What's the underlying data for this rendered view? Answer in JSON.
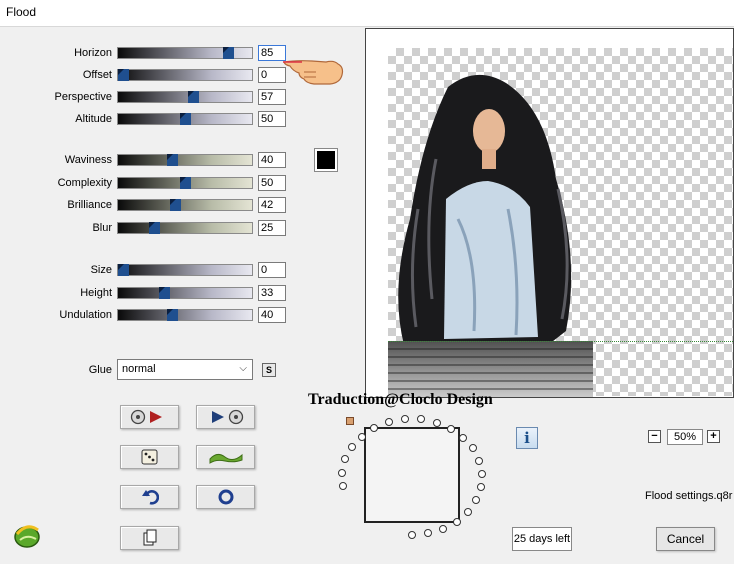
{
  "window": {
    "title": "Flood"
  },
  "params": [
    {
      "id": "horizon",
      "label": "Horizon",
      "value": "85",
      "fraction": 0.85,
      "focused": true
    },
    {
      "id": "offset",
      "label": "Offset",
      "value": "0",
      "fraction": 0.0
    },
    {
      "id": "perspective",
      "label": "Perspective",
      "value": "57",
      "fraction": 0.57
    },
    {
      "id": "altitude",
      "label": "Altitude",
      "value": "50",
      "fraction": 0.5
    },
    {
      "id": "waviness",
      "label": "Waviness",
      "value": "40",
      "fraction": 0.4
    },
    {
      "id": "complexity",
      "label": "Complexity",
      "value": "50",
      "fraction": 0.5
    },
    {
      "id": "brilliance",
      "label": "Brilliance",
      "value": "42",
      "fraction": 0.42
    },
    {
      "id": "blur",
      "label": "Blur",
      "value": "25",
      "fraction": 0.25
    },
    {
      "id": "size",
      "label": "Size",
      "value": "0",
      "fraction": 0.0
    },
    {
      "id": "height",
      "label": "Height",
      "value": "33",
      "fraction": 0.33
    },
    {
      "id": "undulation",
      "label": "Undulation",
      "value": "40",
      "fraction": 0.4
    }
  ],
  "color": {
    "swatch": "#000000"
  },
  "glue": {
    "label": "Glue",
    "value": "normal",
    "s_label": "S"
  },
  "credit": "Traduction@Cloclo Design",
  "zoom": {
    "value": "50%",
    "minus": "−",
    "plus": "+"
  },
  "info_label": "i",
  "settings_file": "Flood settings.q8r",
  "trial": {
    "label": "25 days left"
  },
  "cancel": {
    "label": "Cancel"
  },
  "colors": {
    "accent_blue": "#1f4f8f",
    "preview_border": "#444444"
  },
  "icons": [
    "pointing-hand-icon",
    "play-icon",
    "dice-icon",
    "wave-icon",
    "undo-icon",
    "reset-ring-icon",
    "copy-icon",
    "info-icon",
    "app-logo-icon",
    "chevron-down-icon"
  ]
}
